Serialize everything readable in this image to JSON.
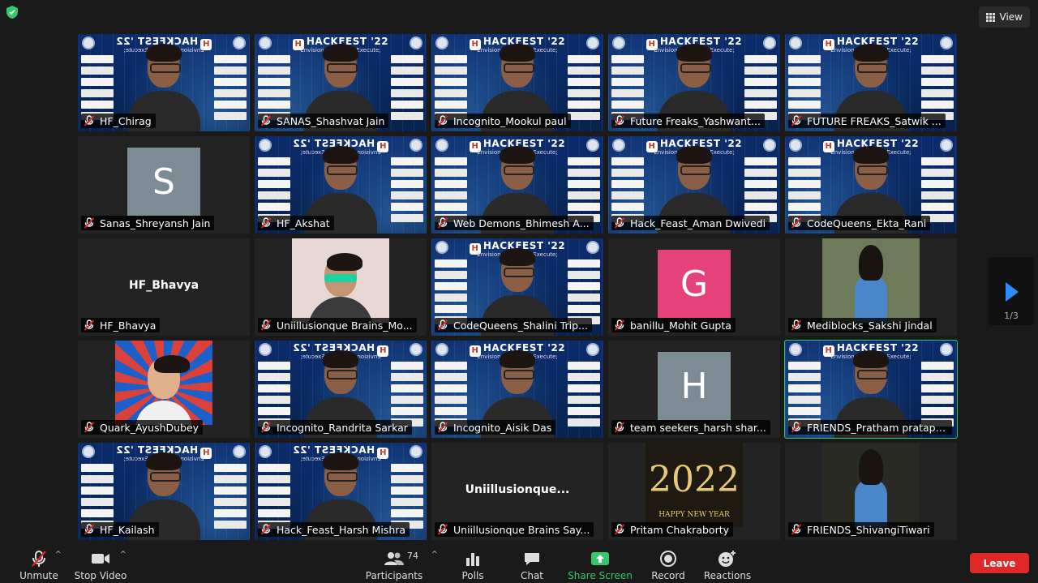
{
  "view": {
    "label": "View",
    "icon": "grid-icon"
  },
  "pager": {
    "page": "1/3",
    "icon": "next-page-icon"
  },
  "tiles": [
    {
      "label": "HF_Chirag",
      "kind": "hackfest",
      "mirror": true
    },
    {
      "label": "SANAS_Shashvat Jain",
      "kind": "hackfest"
    },
    {
      "label": "Incognito_Mookul paul",
      "kind": "hackfest"
    },
    {
      "label": "Future Freaks_Yashwant...",
      "kind": "hackfest"
    },
    {
      "label": "FUTURE FREAKS_Satwik ...",
      "kind": "hackfest"
    },
    {
      "label": "Sanas_Shreyansh Jain",
      "kind": "avatar",
      "letter": "S",
      "color": "#7d8b95"
    },
    {
      "label": "HF_Akshat",
      "kind": "hackfest",
      "mirror": true
    },
    {
      "label": "Web Demons_Bhimesh A...",
      "kind": "hackfest"
    },
    {
      "label": "Hack_Feast_Aman Dwivedi",
      "kind": "hackfest"
    },
    {
      "label": "CodeQueens_Ekta_Rani",
      "kind": "hackfest"
    },
    {
      "label": "HF_Bhavya",
      "kind": "name",
      "center_name": "HF_Bhavya"
    },
    {
      "label": "Uniillusionque Brains_Mo...",
      "kind": "photo",
      "color": "#e7d8d6"
    },
    {
      "label": "CodeQueens_Shalini Trip...",
      "kind": "hackfest"
    },
    {
      "label": "banillu_Mohit Gupta",
      "kind": "avatar",
      "letter": "G",
      "color": "#e5417a"
    },
    {
      "label": "Mediblocks_Sakshi Jindal",
      "kind": "photo",
      "color": "#6e7a5a"
    },
    {
      "label": "Quark_AyushDubey",
      "kind": "photo",
      "color": "#d9413a"
    },
    {
      "label": "Incognito_Randrita Sarkar",
      "kind": "hackfest",
      "mirror": true
    },
    {
      "label": "Incognito_Aisik Das",
      "kind": "hackfest"
    },
    {
      "label": "team seekers_harsh shar...",
      "kind": "avatar",
      "letter": "H",
      "color": "#7d8b95"
    },
    {
      "label": "FRIENDS_Pratham pratap ...",
      "kind": "hackfest",
      "active": true
    },
    {
      "label": "HF_Kailash",
      "kind": "hackfest",
      "mirror": true
    },
    {
      "label": "Hack_Feast_Harsh Mishra",
      "kind": "hackfest",
      "mirror": true
    },
    {
      "label": "Uniillusionque Brains Say...",
      "kind": "name",
      "center_name": "Uniillusionque..."
    },
    {
      "label": "Pritam Chakraborty",
      "kind": "photo",
      "color": "#1e1a12"
    },
    {
      "label": "FRIENDS_ShivangiTiwari",
      "kind": "photo",
      "color": "#2a2a24"
    }
  ],
  "hackfest": {
    "title": "HACKFEST '22",
    "subtitle": "Envision; Evaluate; Execute;"
  },
  "new_year": {
    "year": "2022",
    "text": "HAPPY NEW YEAR"
  },
  "toolbar": {
    "unmute": "Unmute",
    "stop_video": "Stop Video",
    "participants": "Participants",
    "participants_count": "74",
    "polls": "Polls",
    "chat": "Chat",
    "share_screen": "Share Screen",
    "record": "Record",
    "reactions": "Reactions",
    "leave": "Leave"
  },
  "colors": {
    "accent_green": "#35c76b",
    "leave_red": "#e02828",
    "zoom_blue": "#2d8cff"
  }
}
